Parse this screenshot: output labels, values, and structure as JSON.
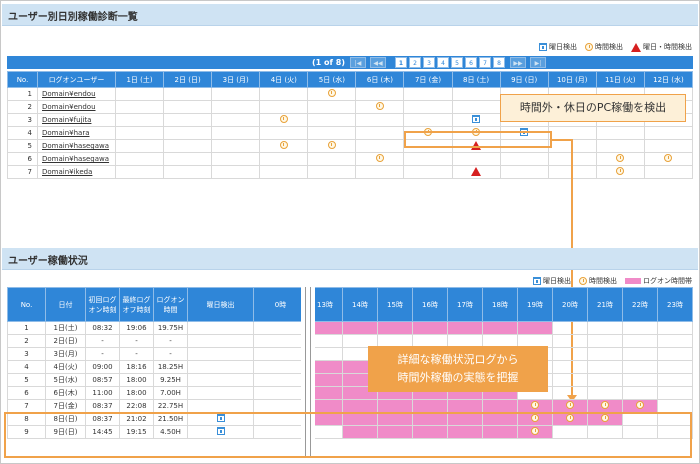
{
  "section1": {
    "title": "ユーザー別日別稼働診断一覧"
  },
  "legend1": {
    "weekday": "曜日検出",
    "time": "時間検出",
    "both": "曜日・時間検出"
  },
  "pager": {
    "label": "(1 of 8)",
    "pages": [
      "1",
      "2",
      "3",
      "4",
      "5",
      "6",
      "7",
      "8"
    ],
    "first": "|◀",
    "prev": "◀◀",
    "next": "▶▶",
    "last": "▶|"
  },
  "table1": {
    "headers": [
      "No.",
      "ログオンユーザー",
      "1日 (土)",
      "2日 (日)",
      "3日 (月)",
      "4日 (火)",
      "5日 (水)",
      "6日 (木)",
      "7日 (金)",
      "8日 (土)",
      "9日 (日)",
      "10日 (月)",
      "11日 (火)",
      "12日 (水)"
    ],
    "rows": [
      {
        "no": "1",
        "user": "Domain¥endou"
      },
      {
        "no": "2",
        "user": "Domain¥endou"
      },
      {
        "no": "3",
        "user": "Domain¥fujita"
      },
      {
        "no": "4",
        "user": "Domain¥hara"
      },
      {
        "no": "5",
        "user": "Domain¥hasegawa"
      },
      {
        "no": "6",
        "user": "Domain¥hasegawa"
      },
      {
        "no": "7",
        "user": "Domain¥ikeda"
      }
    ]
  },
  "callout1": "時間外・休日のPC稼働を検出",
  "section2": {
    "title": "ユーザー稼働状況"
  },
  "legend2": {
    "weekday": "曜日検出",
    "time": "時間検出",
    "band": "ログオン時間帯"
  },
  "table2": {
    "headers": [
      "No.",
      "日付",
      "初回ログオン時刻",
      "最終ログオフ時刻",
      "ログオン時間",
      "曜日検出",
      "0時",
      "13時",
      "14時",
      "15時",
      "16時",
      "17時",
      "18時",
      "19時",
      "20時",
      "21時",
      "22時",
      "23時"
    ],
    "rows": [
      {
        "no": "1",
        "date": "1日(土)",
        "on": "08:32",
        "off": "19:06",
        "hours": "19.75H"
      },
      {
        "no": "2",
        "date": "2日(日)",
        "on": "-",
        "off": "-",
        "hours": "-"
      },
      {
        "no": "3",
        "date": "3日(月)",
        "on": "-",
        "off": "-",
        "hours": "-"
      },
      {
        "no": "4",
        "date": "4日(火)",
        "on": "09:00",
        "off": "18:16",
        "hours": "18.25H"
      },
      {
        "no": "5",
        "date": "5日(水)",
        "on": "08:57",
        "off": "18:00",
        "hours": "9.25H"
      },
      {
        "no": "6",
        "date": "6日(木)",
        "on": "11:00",
        "off": "18:00",
        "hours": "7.00H"
      },
      {
        "no": "7",
        "date": "7日(金)",
        "on": "08:37",
        "off": "22:08",
        "hours": "22.75H"
      },
      {
        "no": "8",
        "date": "8日(日)",
        "on": "08:37",
        "off": "21:02",
        "hours": "21.50H"
      },
      {
        "no": "9",
        "date": "9日(日)",
        "on": "14:45",
        "off": "19:15",
        "hours": "4.50H"
      }
    ]
  },
  "callout2": {
    "line1": "詳細な稼働状況ログから",
    "line2": "時間外稼働の実態を把握"
  },
  "colors": {
    "header": "#2f86d8",
    "band": "#f08bc8",
    "accent": "#f0a24a",
    "warn": "#d61f1f"
  }
}
